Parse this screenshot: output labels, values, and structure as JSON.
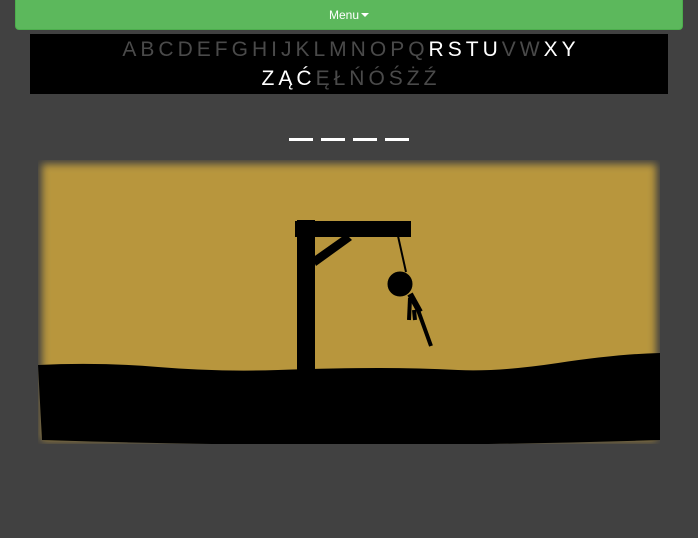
{
  "menu": {
    "label": "Menu"
  },
  "alphabet": [
    {
      "l": "A",
      "on": false
    },
    {
      "l": "B",
      "on": false
    },
    {
      "l": "C",
      "on": false
    },
    {
      "l": "D",
      "on": false
    },
    {
      "l": "E",
      "on": false
    },
    {
      "l": "F",
      "on": false
    },
    {
      "l": "G",
      "on": false
    },
    {
      "l": "H",
      "on": false
    },
    {
      "l": "I",
      "on": false
    },
    {
      "l": "J",
      "on": false
    },
    {
      "l": "K",
      "on": false
    },
    {
      "l": "L",
      "on": false
    },
    {
      "l": "M",
      "on": false
    },
    {
      "l": "N",
      "on": false
    },
    {
      "l": "O",
      "on": false
    },
    {
      "l": "P",
      "on": false
    },
    {
      "l": "Q",
      "on": false
    },
    {
      "l": "R",
      "on": true
    },
    {
      "l": "S",
      "on": true
    },
    {
      "l": "T",
      "on": true
    },
    {
      "l": "U",
      "on": true
    },
    {
      "l": "V",
      "on": false
    },
    {
      "l": "W",
      "on": false
    },
    {
      "l": "X",
      "on": true
    },
    {
      "l": "Y",
      "on": true
    },
    {
      "l": "Z",
      "on": true
    },
    {
      "l": "Ą",
      "on": true
    },
    {
      "l": "Ć",
      "on": true
    },
    {
      "l": "Ę",
      "on": false
    },
    {
      "l": "Ł",
      "on": false
    },
    {
      "l": "Ń",
      "on": false
    },
    {
      "l": "Ó",
      "on": false
    },
    {
      "l": "Ś",
      "on": false
    },
    {
      "l": "Ż",
      "on": false
    },
    {
      "l": "Ź",
      "on": false
    }
  ],
  "word": {
    "blanks": 4
  },
  "colors": {
    "menu": "#5cb85c",
    "sky": "#b8963c",
    "enabled_letter": "#ffffff",
    "disabled_letter": "#4a4a4a"
  }
}
